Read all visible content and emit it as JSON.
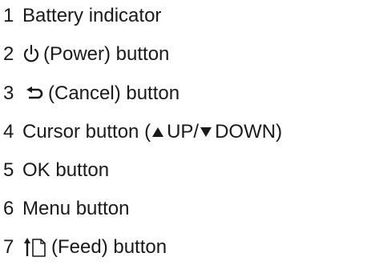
{
  "items": [
    {
      "number": "1",
      "label": "Battery indicator"
    },
    {
      "number": "2",
      "label": "(Power) button",
      "icon": "power-icon"
    },
    {
      "number": "3",
      "label": "(Cancel) button",
      "icon": "cancel-return-arrow-icon"
    },
    {
      "number": "4",
      "label_pre": "Cursor button (",
      "up": "UP/",
      "down": "DOWN)",
      "icons": [
        "up-triangle-icon",
        "down-triangle-icon"
      ]
    },
    {
      "number": "5",
      "label": "OK button"
    },
    {
      "number": "6",
      "label": "Menu button"
    },
    {
      "number": "7",
      "label": "(Feed) button",
      "icon": "feed-paper-icon"
    }
  ]
}
